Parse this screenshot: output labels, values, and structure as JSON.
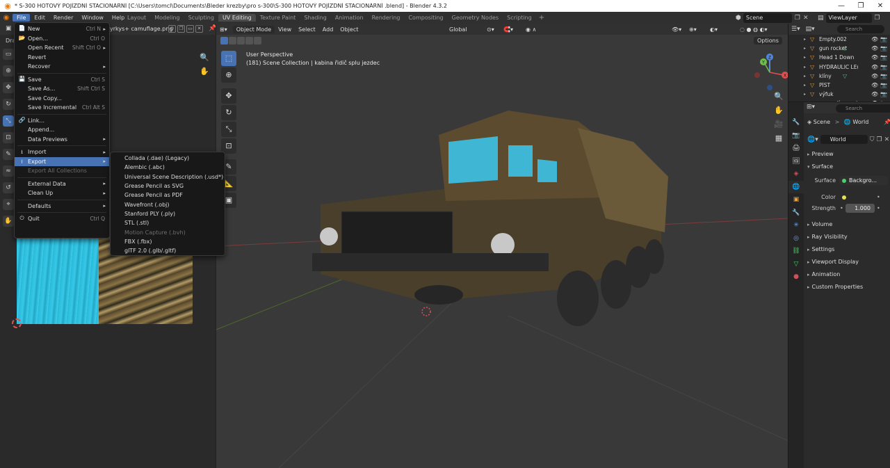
{
  "window": {
    "title": "* S-300 HOTOVÝ POJÍZDNÍ STACIONÁRNÍ  [C:\\Users\\tomcl\\Documents\\Bleder krezby\\pro s-300\\S-300 HOTOVÝ POJÍZDNÍ STACIONÁRNÍ .blend] - Blender 4.3.2",
    "minimize": "—",
    "maximize": "❐",
    "close": "✕"
  },
  "menubar": {
    "items": [
      "File",
      "Edit",
      "Render",
      "Window",
      "Help"
    ]
  },
  "workspaces": {
    "tabs": [
      "Layout",
      "Modeling",
      "Sculpting",
      "UV Editing",
      "Texture Paint",
      "Shading",
      "Animation",
      "Rendering",
      "Compositing",
      "Geometry Nodes",
      "Scripting"
    ],
    "active": "UV Editing",
    "add": "+"
  },
  "scene": {
    "name": "Scene",
    "view_layer": "ViewLayer"
  },
  "image_editor": {
    "image_name": "yrkys+ camuflage.png",
    "tool_header_label": "Dra"
  },
  "file_menu": {
    "items": [
      {
        "label": "New",
        "shortcut": "Ctrl N",
        "submenu": true,
        "icon": "📄"
      },
      {
        "label": "Open...",
        "shortcut": "Ctrl O",
        "icon": "📂"
      },
      {
        "label": "Open Recent",
        "shortcut": "Shift Ctrl O",
        "submenu": true
      },
      {
        "label": "Revert"
      },
      {
        "label": "Recover",
        "submenu": true
      },
      {
        "sep": true
      },
      {
        "label": "Save",
        "shortcut": "Ctrl S",
        "icon": "💾"
      },
      {
        "label": "Save As...",
        "shortcut": "Shift Ctrl S"
      },
      {
        "label": "Save Copy..."
      },
      {
        "label": "Save Incremental",
        "shortcut": "Ctrl Alt S"
      },
      {
        "sep": true
      },
      {
        "label": "Link...",
        "icon": "🔗"
      },
      {
        "label": "Append..."
      },
      {
        "label": "Data Previews",
        "submenu": true
      },
      {
        "sep": true
      },
      {
        "label": "Import",
        "submenu": true,
        "icon": "⭳"
      },
      {
        "label": "Export",
        "submenu": true,
        "active": true,
        "icon": "⭱"
      },
      {
        "label": "Export All Collections",
        "disabled": true
      },
      {
        "sep": true
      },
      {
        "label": "External Data",
        "submenu": true
      },
      {
        "label": "Clean Up",
        "submenu": true
      },
      {
        "sep": true
      },
      {
        "label": "Defaults",
        "submenu": true
      },
      {
        "sep": true
      },
      {
        "label": "Quit",
        "shortcut": "Ctrl Q",
        "icon": "⏻"
      }
    ]
  },
  "export_menu": {
    "items": [
      {
        "label": "Collada (.dae) (Legacy)"
      },
      {
        "label": "Alembic (.abc)"
      },
      {
        "label": "Universal Scene Description (.usd*)"
      },
      {
        "label": "Grease Pencil as SVG"
      },
      {
        "label": "Grease Pencil as PDF"
      },
      {
        "label": "Wavefront (.obj)"
      },
      {
        "label": "Stanford PLY (.ply)"
      },
      {
        "label": "STL (.stl)"
      },
      {
        "label": "Motion Capture (.bvh)",
        "disabled": true
      },
      {
        "label": "FBX (.fbx)"
      },
      {
        "label": "glTF 2.0 (.glb/.gltf)"
      }
    ]
  },
  "viewport": {
    "mode": "Object Mode",
    "menus": [
      "View",
      "Select",
      "Add",
      "Object"
    ],
    "orientation": "Global",
    "options": "Options",
    "info_line1": "User Perspective",
    "info_line2": "(181) Scene Collection | kabina řidič splu jezdec",
    "gizmo": {
      "x": "X",
      "y": "Y",
      "z": "Z"
    }
  },
  "outliner": {
    "search_placeholder": "Search",
    "rows": [
      {
        "name": "Empty.002"
      },
      {
        "name": "gun rocket"
      },
      {
        "name": "Head 1 Down"
      },
      {
        "name": "HYDRAULIC LE("
      },
      {
        "name": "klíny"
      },
      {
        "name": "PÍST"
      },
      {
        "name": "výfuk"
      },
      {
        "name": "...mn_díra spojení"
      }
    ]
  },
  "properties": {
    "search_placeholder": "Search",
    "breadcrumb_scene": "Scene",
    "breadcrumb_sep": ">",
    "breadcrumb_world": "World",
    "world_name": "World",
    "panels": {
      "preview": "Preview",
      "surface": "Surface",
      "surface_label": "Surface",
      "surface_value": "Backgro...",
      "color_label": "Color",
      "strength_label": "Strength",
      "strength_value": "1.000",
      "volume": "Volume",
      "ray_visibility": "Ray Visibility",
      "settings": "Settings",
      "viewport_display": "Viewport Display",
      "animation": "Animation",
      "custom_properties": "Custom Properties"
    }
  },
  "colors": {
    "accent": "#4772b3",
    "blender_orange": "#e87d0d",
    "menu_bg": "#181818",
    "viewport_bg": "#393939"
  }
}
